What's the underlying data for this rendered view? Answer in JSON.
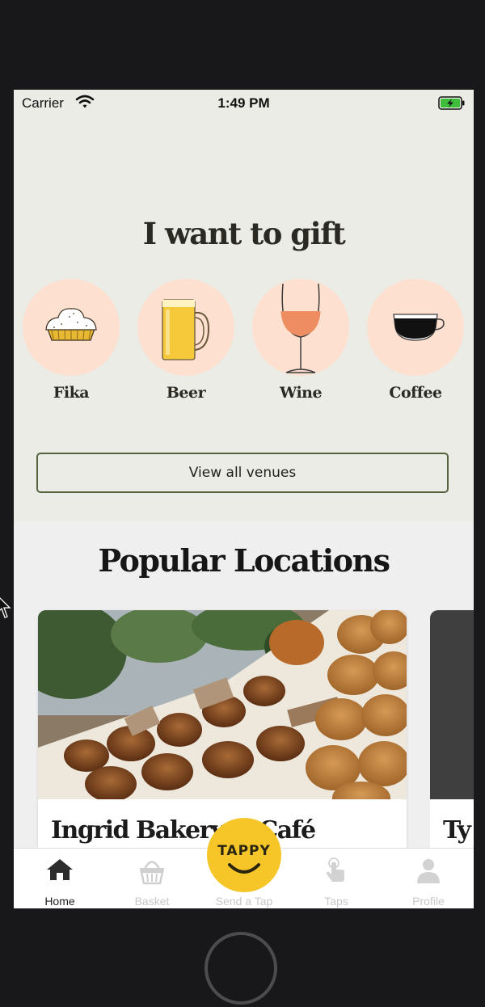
{
  "status_bar": {
    "carrier": "Carrier",
    "time": "1:49 PM",
    "wifi_icon": "wifi-icon",
    "battery_icon": "battery-charging-icon"
  },
  "gift": {
    "title": "I want to gift",
    "categories": [
      {
        "label": "Fika",
        "icon": "cinnamon-bun-icon"
      },
      {
        "label": "Beer",
        "icon": "beer-mug-icon"
      },
      {
        "label": "Wine",
        "icon": "wine-glass-icon"
      },
      {
        "label": "Coffee",
        "icon": "coffee-cup-icon"
      }
    ],
    "view_all_label": "View all venues"
  },
  "popular": {
    "title": "Popular Locations",
    "venues": [
      {
        "name": "Ingrid Bakery & Café"
      },
      {
        "name": "Ty"
      }
    ]
  },
  "tabs": [
    {
      "label": "Home",
      "icon": "home-icon",
      "active": true
    },
    {
      "label": "Basket",
      "icon": "basket-icon",
      "active": false
    },
    {
      "label": "Send a Tap",
      "icon": "tappy-logo",
      "active": false
    },
    {
      "label": "Taps",
      "icon": "tap-hand-icon",
      "active": false
    },
    {
      "label": "Profile",
      "icon": "profile-icon",
      "active": false
    }
  ],
  "tappy_button": {
    "text": "TAPPY"
  },
  "colors": {
    "gift_background": "#ebece6",
    "category_circle": "#fde0d0",
    "button_border": "#56623e",
    "tappy_yellow": "#f6c629",
    "device_frame": "#18171a"
  }
}
